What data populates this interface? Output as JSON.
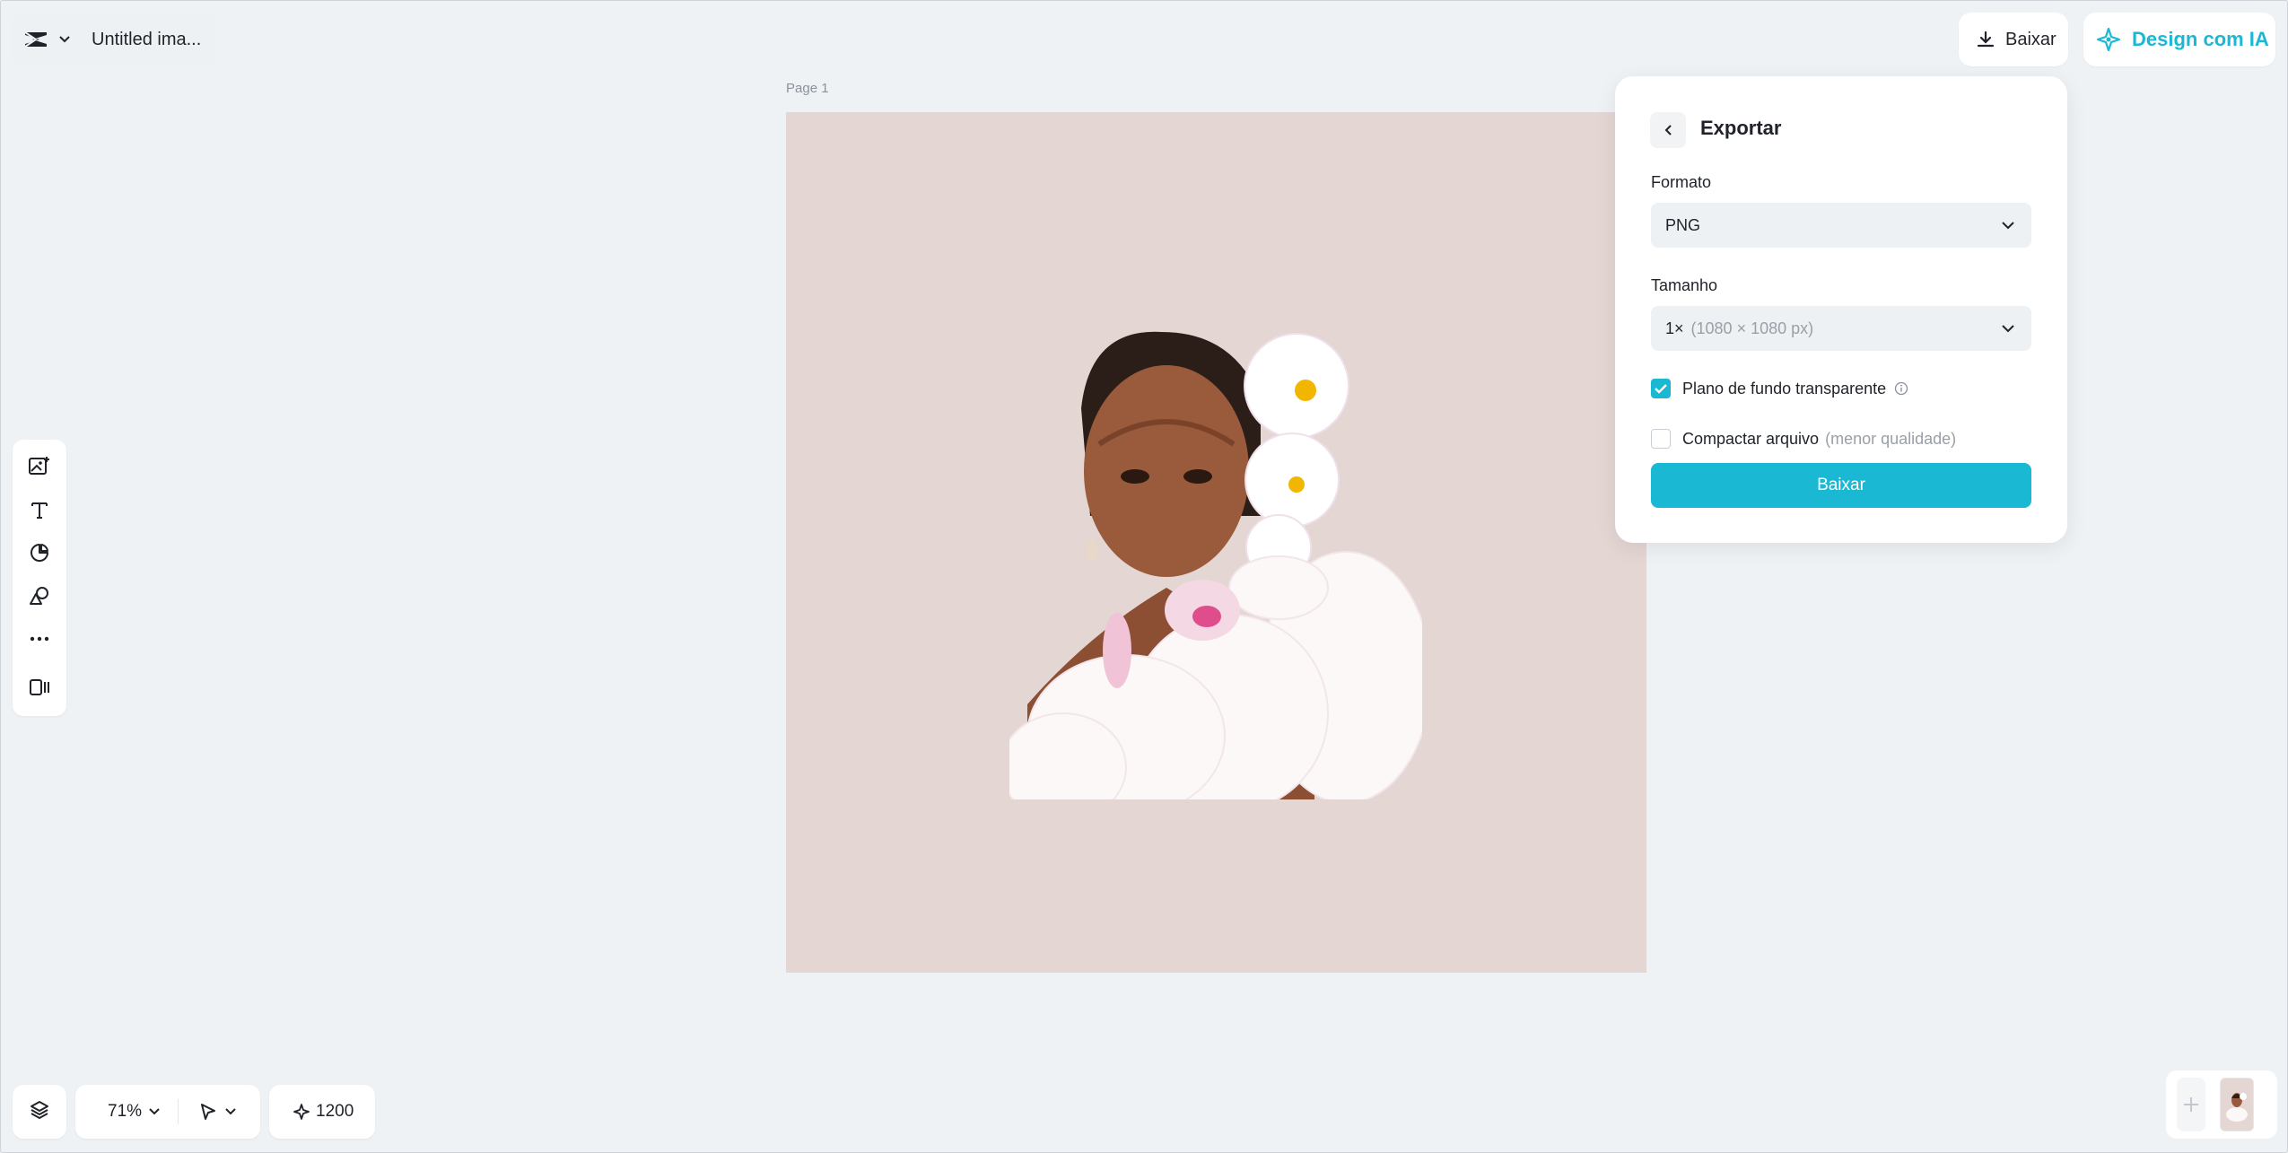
{
  "header": {
    "doc_title": "Untitled ima...",
    "download_label": "Baixar",
    "ai_label": "Design com IA"
  },
  "canvas": {
    "page_label": "Page 1",
    "background_color": "#e4d6d3"
  },
  "left_toolbar": {
    "tools": [
      "image-add-icon",
      "text-icon",
      "sticker-icon",
      "shapes-icon",
      "more-icon",
      "resize-icon"
    ]
  },
  "bottom_bar": {
    "zoom": "71%",
    "credits": "1200"
  },
  "export_panel": {
    "title": "Exportar",
    "format_label": "Formato",
    "format_value": "PNG",
    "size_label": "Tamanho",
    "size_value": "1×",
    "size_detail": "(1080 × 1080 px)",
    "transparent_label": "Plano de fundo transparente",
    "transparent_checked": true,
    "compress_label": "Compactar arquivo",
    "compress_note": "(menor qualidade)",
    "compress_checked": false,
    "download_button": "Baixar"
  },
  "colors": {
    "accent": "#1bb8d4",
    "app_background": "#eff2f5"
  }
}
